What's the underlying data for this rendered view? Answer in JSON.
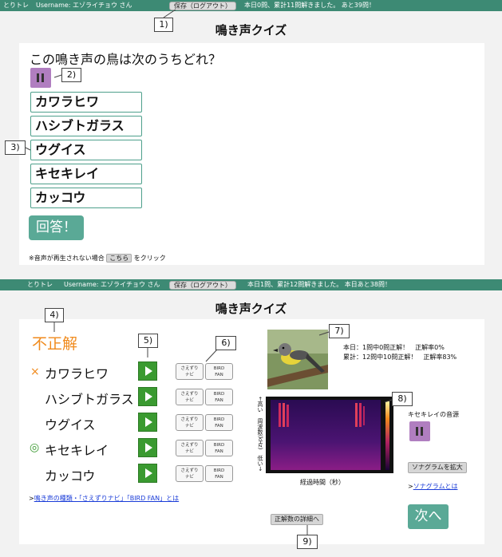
{
  "colors": {
    "header_bg": "#3d8a74",
    "accent": "#5aa996",
    "wrong": "#f08a1c",
    "play": "#b07ec0",
    "go": "#3a9a30"
  },
  "screen1": {
    "header": {
      "logo": "とりトレ",
      "username": "Username: エゾライチョウ さん",
      "logout": "保存（ログアウト）",
      "status": "本日0問、累計11問解きました。 あと39問！"
    },
    "title": "鳴き声クイズ",
    "question": "この鳴き声の鳥は次のうちどれ？",
    "choices": [
      "カワラヒワ",
      "ハシブトガラス",
      "ウグイス",
      "キセキレイ",
      "カッコウ"
    ],
    "answer_button": "回答！",
    "note_before": "※音声が再生されない場合",
    "note_button": "こちら",
    "note_after": "をクリック"
  },
  "screen2": {
    "header": {
      "logo": "とりトレ",
      "username": "Username: エゾライチョウ さん",
      "logout": "保存（ログアウト）",
      "status": "本日1問、累計12問解きました。 本日あと38問！"
    },
    "title": "鳴き声クイズ",
    "result": "不正解",
    "rows": [
      {
        "mark": "×",
        "name": "カワラヒワ",
        "btn1": "さえずり\nナビ",
        "btn2": "BIRD\nFAN"
      },
      {
        "mark": "",
        "name": "ハシブトガラス",
        "btn1": "さえずり\nナビ",
        "btn2": "BIRD\nFAN"
      },
      {
        "mark": "",
        "name": "ウグイス",
        "btn1": "さえずり\nナビ",
        "btn2": "BIRD\nFAN"
      },
      {
        "mark": "◎",
        "name": "キセキレイ",
        "btn1": "さえずり\nナビ",
        "btn2": "BIRD\nFAN"
      },
      {
        "mark": "",
        "name": "カッコウ",
        "btn1": "さえずり\nナビ",
        "btn2": "BIRD\nFAN"
      }
    ],
    "help_link_prefix": ">",
    "help_link": "鳴き声の種類・「さえずりナビ」「BIRD FAN」とは",
    "stats_today": "本日：1問中0問正解！　正解率0%",
    "stats_total": "累計：12問中10問正解！　正解率83%",
    "spec_ylabel": "←高い　周波数(kHz)　低い→",
    "spec_xlabel": "経過時間（秒）",
    "source_label": "キセキレイの音源",
    "enlarge_button": "ソナグラムを拡大",
    "sonagram_link_prefix": ">",
    "sonagram_link": "ソナグラムとは",
    "next_button": "次へ",
    "details_button": "正解数の詳細へ"
  },
  "callouts": [
    "1)",
    "2)",
    "3)",
    "4)",
    "5)",
    "6)",
    "7)",
    "8)",
    "9)"
  ]
}
